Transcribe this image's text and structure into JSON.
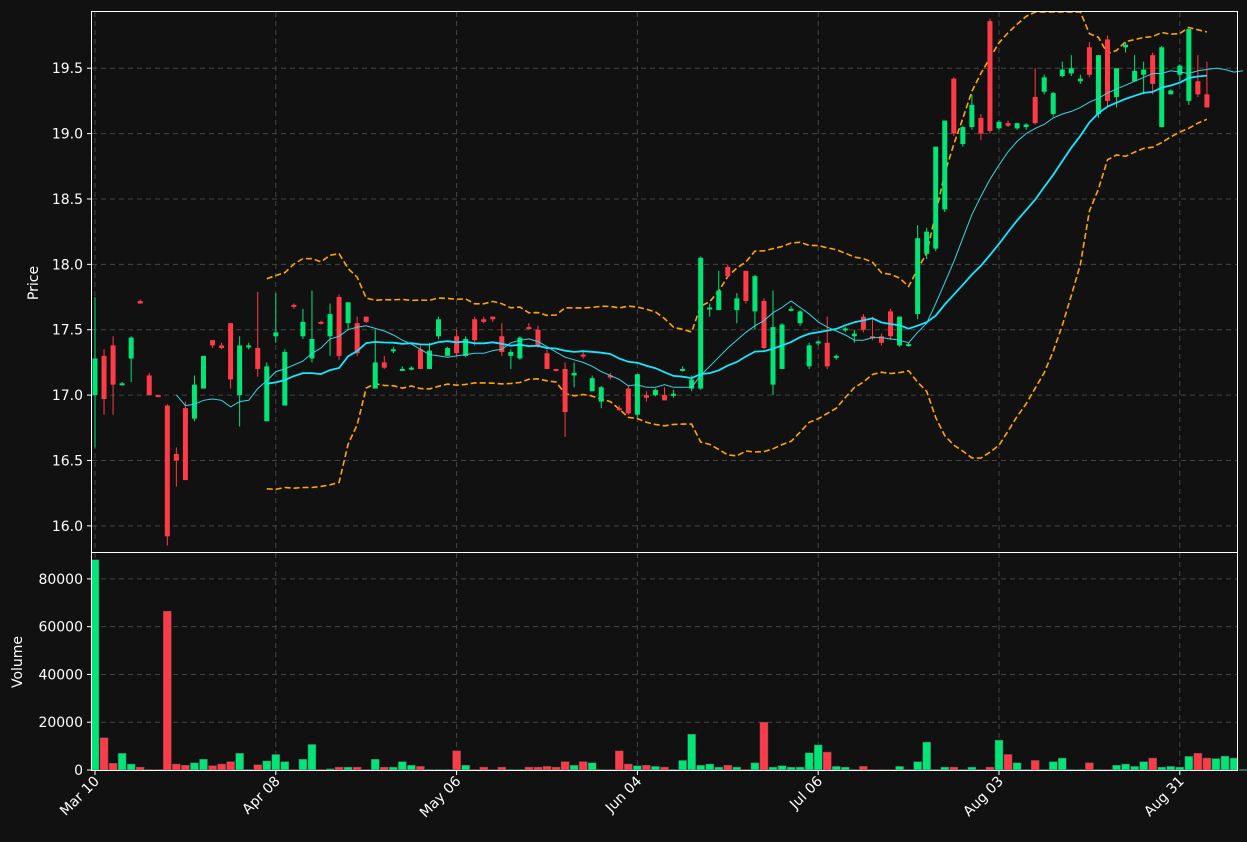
{
  "colors": {
    "background": "#111111",
    "up": "#00e676",
    "down": "#ff3b47",
    "ma_fast": "#39d6e0",
    "ma_slow": "#18e6ff",
    "bands": "#ffa500",
    "axes": "#ffffff",
    "grid": "#444444"
  },
  "chart_data": {
    "type": "candlestick",
    "grid": true,
    "price_panel": {
      "ylabel": "Price",
      "ylim": [
        15.8,
        19.93
      ],
      "yticks": [
        "16.0",
        "16.5",
        "17.0",
        "17.5",
        "18.0",
        "18.5",
        "19.0",
        "19.5"
      ],
      "ohlc": [
        [
          17.0,
          17.75,
          16.6,
          17.28
        ],
        [
          17.3,
          17.35,
          16.85,
          16.97
        ],
        [
          17.38,
          17.45,
          16.85,
          17.08
        ],
        [
          17.08,
          17.1,
          17.08,
          17.09
        ],
        [
          17.28,
          17.45,
          17.1,
          17.44
        ],
        [
          17.72,
          17.73,
          17.7,
          17.7
        ],
        [
          17.15,
          17.17,
          17.0,
          17.0
        ],
        [
          17.0,
          17.0,
          17.0,
          16.99
        ],
        [
          16.92,
          16.93,
          15.85,
          15.92
        ],
        [
          16.55,
          16.6,
          16.3,
          16.5
        ],
        [
          16.9,
          16.95,
          16.35,
          16.35
        ],
        [
          16.82,
          17.15,
          16.8,
          17.08
        ],
        [
          17.05,
          17.3,
          17.05,
          17.3
        ],
        [
          17.42,
          17.42,
          17.36,
          17.38
        ],
        [
          17.38,
          17.4,
          17.35,
          17.36
        ],
        [
          17.55,
          17.55,
          17.05,
          17.12
        ],
        [
          17.0,
          17.45,
          16.76,
          17.38
        ],
        [
          17.38,
          17.4,
          17.35,
          17.38
        ],
        [
          17.36,
          17.79,
          17.14,
          17.2
        ],
        [
          16.8,
          17.25,
          16.8,
          17.22
        ],
        [
          17.45,
          17.78,
          17.4,
          17.48
        ],
        [
          16.92,
          17.35,
          16.92,
          17.33
        ],
        [
          17.69,
          17.7,
          17.66,
          17.68
        ],
        [
          17.45,
          17.66,
          17.43,
          17.56
        ],
        [
          17.28,
          17.8,
          17.25,
          17.43
        ],
        [
          17.56,
          17.57,
          17.54,
          17.55
        ],
        [
          17.45,
          17.7,
          17.3,
          17.62
        ],
        [
          17.75,
          17.77,
          17.27,
          17.3
        ],
        [
          17.55,
          17.6,
          17.5,
          17.71
        ],
        [
          17.55,
          17.6,
          17.3,
          17.32
        ],
        [
          17.6,
          17.6,
          17.55,
          17.56
        ],
        [
          17.05,
          17.5,
          17.05,
          17.25
        ],
        [
          17.25,
          17.3,
          17.2,
          17.21
        ],
        [
          17.35,
          17.37,
          17.32,
          17.35
        ],
        [
          17.2,
          17.22,
          17.19,
          17.2
        ],
        [
          17.2,
          17.22,
          17.19,
          17.21
        ],
        [
          17.35,
          17.38,
          17.2,
          17.2
        ],
        [
          17.2,
          17.4,
          17.2,
          17.34
        ],
        [
          17.45,
          17.6,
          17.43,
          17.58
        ],
        [
          17.3,
          17.37,
          17.3,
          17.36
        ],
        [
          17.45,
          17.5,
          17.3,
          17.32
        ],
        [
          17.3,
          17.45,
          17.29,
          17.43
        ],
        [
          17.58,
          17.6,
          17.38,
          17.42
        ],
        [
          17.58,
          17.6,
          17.55,
          17.56
        ],
        [
          17.6,
          17.6,
          17.56,
          17.58
        ],
        [
          17.45,
          17.55,
          17.3,
          17.33
        ],
        [
          17.3,
          17.35,
          17.2,
          17.33
        ],
        [
          17.28,
          17.45,
          17.27,
          17.44
        ],
        [
          17.52,
          17.55,
          17.5,
          17.51
        ],
        [
          17.5,
          17.53,
          17.36,
          17.37
        ],
        [
          17.32,
          17.35,
          17.2,
          17.2
        ],
        [
          17.2,
          17.2,
          17.18,
          17.19
        ],
        [
          17.2,
          17.25,
          16.68,
          16.87
        ],
        [
          17.15,
          17.25,
          17.06,
          17.17
        ],
        [
          17.31,
          17.33,
          17.28,
          17.3
        ],
        [
          17.03,
          17.15,
          17.03,
          17.13
        ],
        [
          16.95,
          17.07,
          16.9,
          17.06
        ],
        [
          17.15,
          17.17,
          17.12,
          17.14
        ],
        [
          16.9,
          16.92,
          16.88,
          16.89
        ],
        [
          17.05,
          17.07,
          16.85,
          16.86
        ],
        [
          16.85,
          17.16,
          16.83,
          17.16
        ],
        [
          17.0,
          17.03,
          16.95,
          16.98
        ],
        [
          17.0,
          17.05,
          16.99,
          17.04
        ],
        [
          17.0,
          17.06,
          16.97,
          16.96
        ],
        [
          17.0,
          17.04,
          16.98,
          17.01
        ],
        [
          17.2,
          17.22,
          17.18,
          17.2
        ],
        [
          17.05,
          17.15,
          17.03,
          17.12
        ],
        [
          17.05,
          18.06,
          17.04,
          18.05
        ],
        [
          17.67,
          17.7,
          17.6,
          17.67
        ],
        [
          17.65,
          17.95,
          17.65,
          17.8
        ],
        [
          17.98,
          18.0,
          17.9,
          17.91
        ],
        [
          17.65,
          17.78,
          17.55,
          17.74
        ],
        [
          17.95,
          17.95,
          17.7,
          17.72
        ],
        [
          17.64,
          17.92,
          17.5,
          17.91
        ],
        [
          17.72,
          17.74,
          17.35,
          17.36
        ],
        [
          17.08,
          17.8,
          17.0,
          17.52
        ],
        [
          17.2,
          17.55,
          17.2,
          17.54
        ],
        [
          17.66,
          17.68,
          17.64,
          17.66
        ],
        [
          17.55,
          17.65,
          17.53,
          17.64
        ],
        [
          17.22,
          17.4,
          17.2,
          17.38
        ],
        [
          17.4,
          17.42,
          17.38,
          17.41
        ],
        [
          17.4,
          17.6,
          17.2,
          17.22
        ],
        [
          17.29,
          17.31,
          17.27,
          17.3
        ],
        [
          17.5,
          17.52,
          17.48,
          17.51
        ],
        [
          17.45,
          17.5,
          17.4,
          17.47
        ],
        [
          17.6,
          17.62,
          17.48,
          17.5
        ],
        [
          17.45,
          17.6,
          17.42,
          17.44
        ],
        [
          17.45,
          17.47,
          17.38,
          17.4
        ],
        [
          17.64,
          17.66,
          17.42,
          17.45
        ],
        [
          17.38,
          17.6,
          17.37,
          17.6
        ],
        [
          17.38,
          17.4,
          17.37,
          17.39
        ],
        [
          17.62,
          18.3,
          17.58,
          18.2
        ],
        [
          18.08,
          18.28,
          18.04,
          18.25
        ],
        [
          18.12,
          18.9,
          18.1,
          18.9
        ],
        [
          18.42,
          19.1,
          18.4,
          19.1
        ],
        [
          19.42,
          19.43,
          18.98,
          19.0
        ],
        [
          18.92,
          19.06,
          18.9,
          19.05
        ],
        [
          19.05,
          19.3,
          19.03,
          19.22
        ],
        [
          19.12,
          19.15,
          18.95,
          19.0
        ],
        [
          19.86,
          19.88,
          19.0,
          19.02
        ],
        [
          19.04,
          19.1,
          19.03,
          19.09
        ],
        [
          19.08,
          19.1,
          19.05,
          19.06
        ],
        [
          19.04,
          19.08,
          19.03,
          19.08
        ],
        [
          19.05,
          19.08,
          19.03,
          19.07
        ],
        [
          19.28,
          19.5,
          19.07,
          19.08
        ],
        [
          19.32,
          19.45,
          19.3,
          19.43
        ],
        [
          19.15,
          19.32,
          19.13,
          19.31
        ],
        [
          19.44,
          19.55,
          19.43,
          19.49
        ],
        [
          19.46,
          19.6,
          19.44,
          19.5
        ],
        [
          19.4,
          19.45,
          19.38,
          19.42
        ],
        [
          19.66,
          19.7,
          19.43,
          19.45
        ],
        [
          19.15,
          19.6,
          19.12,
          19.6
        ],
        [
          19.72,
          19.75,
          19.2,
          19.25
        ],
        [
          19.28,
          19.5,
          19.2,
          19.5
        ],
        [
          19.66,
          19.7,
          19.62,
          19.68
        ],
        [
          19.4,
          19.6,
          19.4,
          19.48
        ],
        [
          19.45,
          19.55,
          19.3,
          19.49
        ],
        [
          19.6,
          19.62,
          19.3,
          19.38
        ],
        [
          19.05,
          19.67,
          19.05,
          19.66
        ],
        [
          19.3,
          19.34,
          19.3,
          19.33
        ],
        [
          19.45,
          19.53,
          19.4,
          19.52
        ],
        [
          19.25,
          19.8,
          19.22,
          19.8
        ],
        [
          19.4,
          19.6,
          19.28,
          19.3
        ],
        [
          19.3,
          19.55,
          19.2,
          19.2
        ]
      ],
      "ma_fast": [
        null,
        null,
        null,
        null,
        null,
        null,
        null,
        null,
        null,
        17.0,
        16.92,
        16.93,
        16.96,
        16.97,
        16.96,
        16.91,
        16.95,
        16.96,
        17.05,
        17.11,
        17.18,
        17.2,
        17.23,
        17.26,
        17.32,
        17.36,
        17.43,
        17.45,
        17.5,
        17.52,
        17.53,
        17.51,
        17.49,
        17.46,
        17.42,
        17.39,
        17.35,
        17.31,
        17.3,
        17.29,
        17.3,
        17.31,
        17.32,
        17.32,
        17.34,
        17.35,
        17.4,
        17.42,
        17.43,
        17.41,
        17.37,
        17.33,
        17.29,
        17.27,
        17.25,
        17.22,
        17.18,
        17.15,
        17.12,
        17.07,
        17.08,
        17.06,
        17.06,
        17.08,
        17.06,
        17.06,
        17.06,
        17.15,
        17.22,
        17.29,
        17.36,
        17.42,
        17.48,
        17.53,
        17.57,
        17.63,
        17.67,
        17.72,
        17.67,
        17.62,
        17.56,
        17.52,
        17.49,
        17.46,
        17.42,
        17.42,
        17.44,
        17.44,
        17.43,
        17.42,
        17.4,
        17.48,
        17.55,
        17.7,
        17.86,
        18.02,
        18.2,
        18.38,
        18.52,
        18.65,
        18.76,
        18.86,
        18.94,
        19.0,
        19.04,
        19.07,
        19.12,
        19.15,
        19.17,
        19.2,
        19.24,
        19.27,
        19.31,
        19.34,
        19.37,
        19.4,
        19.43,
        19.46,
        19.46,
        19.48,
        19.47,
        19.46,
        19.48,
        19.49,
        19.5,
        19.49,
        19.47,
        19.48
      ]
    },
    "volume_panel": {
      "ylabel": "Volume",
      "ylim": [
        0,
        90000
      ],
      "yticks": [
        "0",
        "20000",
        "40000",
        "60000",
        "80000"
      ],
      "values": [
        88000,
        13500,
        2800,
        7000,
        2500,
        1200,
        200,
        200,
        66500,
        2500,
        2000,
        3000,
        4500,
        1800,
        2500,
        3500,
        7000,
        200,
        2200,
        3800,
        6500,
        3500,
        200,
        4500,
        10700,
        200,
        500,
        1200,
        1200,
        1200,
        200,
        4500,
        1200,
        1200,
        3500,
        2000,
        1500,
        200,
        200,
        200,
        8000,
        2000,
        200,
        1200,
        200,
        1200,
        200,
        200,
        1200,
        1200,
        1500,
        1200,
        3500,
        2000,
        3500,
        3000,
        200,
        200,
        8000,
        2500,
        1800,
        2000,
        1500,
        1200,
        200,
        4000,
        15000,
        2000,
        2500,
        1200,
        2000,
        1200,
        200,
        3000,
        20000,
        1200,
        1800,
        1200,
        1200,
        7200,
        10500,
        7500,
        1500,
        1200,
        200,
        1500,
        200,
        200,
        200,
        1500,
        200,
        3500,
        11700,
        200,
        1200,
        1200,
        200,
        1200,
        200,
        1200,
        12500,
        6500,
        3000,
        200,
        4000,
        200,
        3500,
        5000,
        200,
        200,
        3000,
        200,
        200,
        2000,
        2500,
        1500,
        3500,
        5000,
        1200,
        1500,
        1200,
        5700,
        7000,
        5000,
        4800,
        5800,
        5000,
        200,
        3500,
        2500,
        2500,
        3000,
        1500
      ]
    },
    "x_tick_labels": [
      "Mar 10",
      "Apr 08",
      "May 06",
      "Jun 04",
      "Jul 06",
      "Aug 03",
      "Aug 31"
    ],
    "x_tick_index": [
      0,
      20,
      40,
      60,
      80,
      100,
      120
    ]
  }
}
